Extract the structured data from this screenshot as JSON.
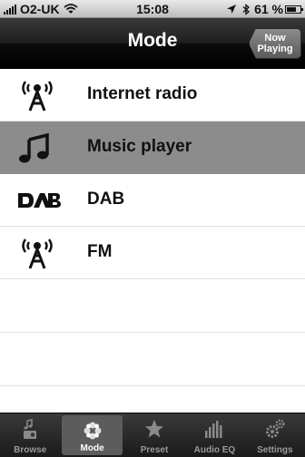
{
  "status_bar": {
    "carrier": "O2-UK",
    "time": "15:08",
    "battery": "61 %"
  },
  "nav": {
    "title": "Mode",
    "now_playing_line1": "Now",
    "now_playing_line2": "Playing"
  },
  "modes": [
    {
      "label": "Internet radio",
      "icon": "radio-tower-icon",
      "selected": false
    },
    {
      "label": "Music player",
      "icon": "music-note-icon",
      "selected": true
    },
    {
      "label": "DAB",
      "icon": "dab-logo-icon",
      "selected": false
    },
    {
      "label": "FM",
      "icon": "radio-tower-icon",
      "selected": false
    }
  ],
  "tabs": [
    {
      "label": "Browse",
      "icon": "browse-icon",
      "active": false
    },
    {
      "label": "Mode",
      "icon": "mode-icon",
      "active": true
    },
    {
      "label": "Preset",
      "icon": "star-icon",
      "active": false
    },
    {
      "label": "Audio EQ",
      "icon": "equalizer-icon",
      "active": false
    },
    {
      "label": "Settings",
      "icon": "gears-icon",
      "active": false
    }
  ],
  "colors": {
    "selected_row": "#8c8c8c",
    "nav_bar": "#1e1e1e",
    "tab_active": "#5c5c5c"
  }
}
